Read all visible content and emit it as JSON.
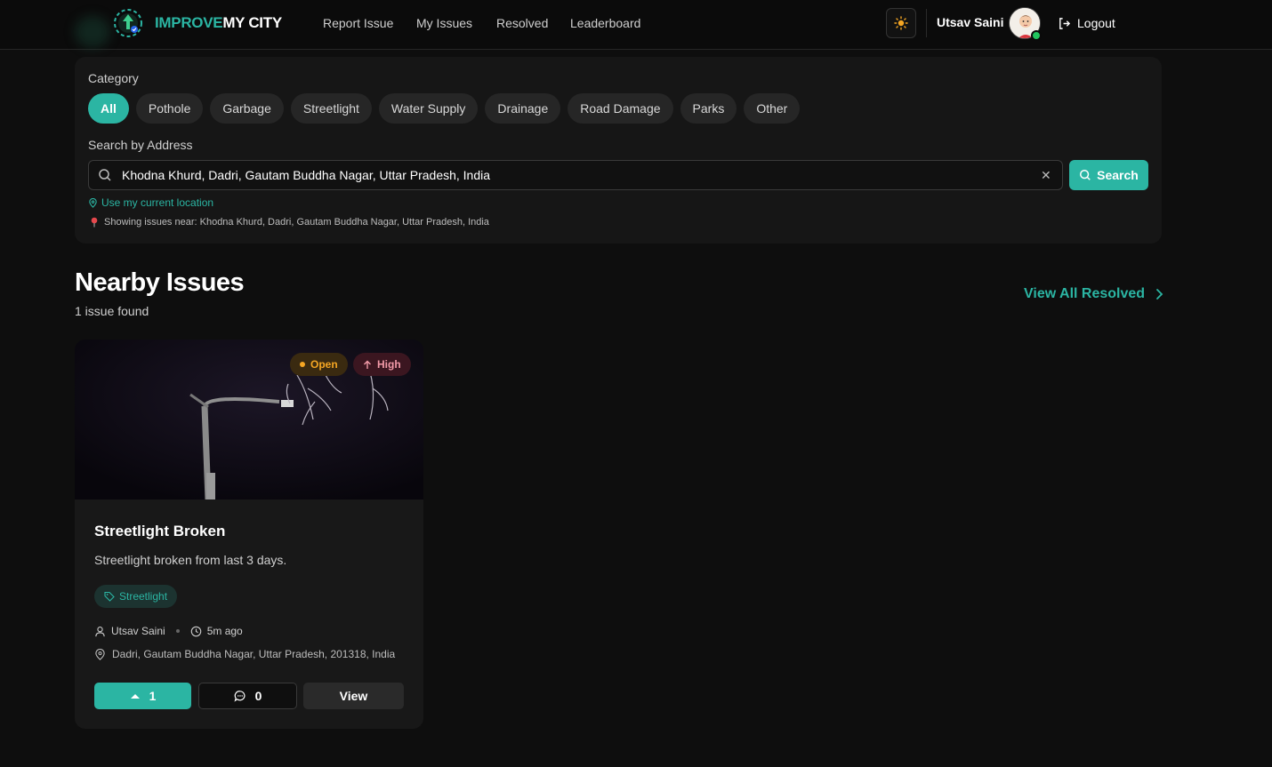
{
  "brand": {
    "part1": "IMPROVE",
    "part2": "MY CITY",
    "accent": "#2bb5a3"
  },
  "nav": {
    "links": [
      "Report Issue",
      "My Issues",
      "Resolved",
      "Leaderboard"
    ],
    "theme_icon": "sun-icon",
    "user_name": "Utsav Saini",
    "logout_label": "Logout"
  },
  "filters": {
    "category_label": "Category",
    "categories": [
      "All",
      "Pothole",
      "Garbage",
      "Streetlight",
      "Water Supply",
      "Drainage",
      "Road Damage",
      "Parks",
      "Other"
    ],
    "selected_category": "All",
    "search_label": "Search by Address",
    "search_value": "Khodna Khurd, Dadri, Gautam Buddha Nagar, Uttar Pradesh, India",
    "search_button": "Search",
    "use_location": "Use my current location",
    "showing_text": "Showing issues near: Khodna Khurd, Dadri, Gautam Buddha Nagar, Uttar Pradesh, India"
  },
  "section": {
    "title": "Nearby Issues",
    "count_text": "1 issue found",
    "view_all": "View All Resolved"
  },
  "issues": [
    {
      "status": "Open",
      "priority": "High",
      "title": "Streetlight Broken",
      "description": "Streetlight broken from last 3 days.",
      "category": "Streetlight",
      "author": "Utsav Saini",
      "time": "5m ago",
      "address": "Dadri, Gautam Buddha Nagar, Uttar Pradesh, 201318, India",
      "upvotes": "1",
      "comments": "0",
      "view_label": "View"
    }
  ]
}
